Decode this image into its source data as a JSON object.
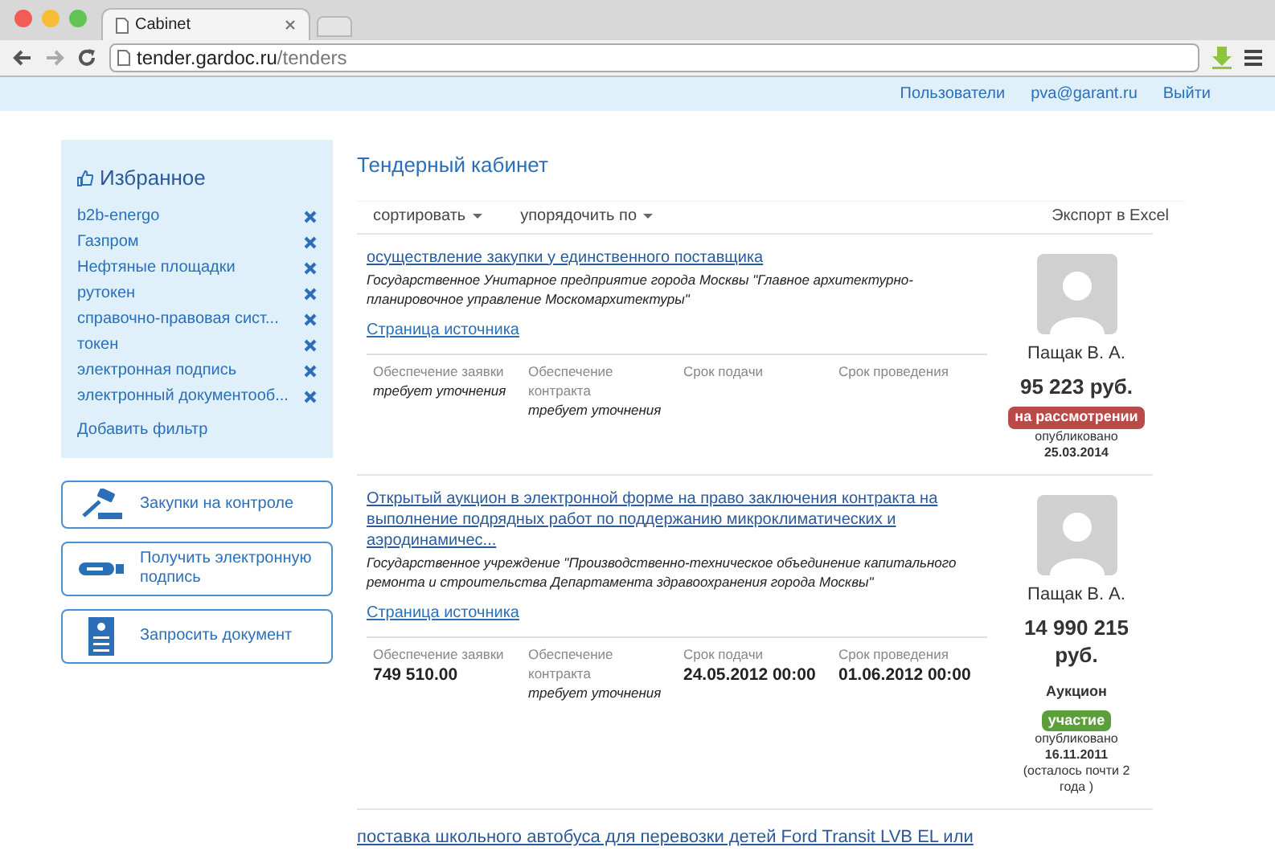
{
  "browser": {
    "tab_title": "Cabinet",
    "url_host": "tender.gardoc.ru",
    "url_path": "/tenders"
  },
  "top_nav": [
    "Пользователи",
    "pva@garant.ru",
    "Выйти"
  ],
  "favorites": {
    "title": "Избранное",
    "items": [
      "b2b-energo",
      "Газпром",
      "Нефтяные площадки",
      "рутокен",
      "справочно-правовая сист...",
      "токен",
      "электронная подпись",
      "электронный документооб..."
    ],
    "add": "Добавить фильтр"
  },
  "actions": [
    {
      "kind": "gavel",
      "label": "Закупки на контроле"
    },
    {
      "kind": "token",
      "label": "Получить электронную подпись"
    },
    {
      "kind": "document",
      "label": "Запросить документ"
    }
  ],
  "page_title": "Тендерный кабинет",
  "toolbar": {
    "sort": "сортировать",
    "order": "упорядочить по",
    "export": "Экспорт в Excel"
  },
  "tenders": [
    {
      "title": "осуществление закупки у единственного поставщика",
      "customer": "Государственное Унитарное предприятие города Москвы \"Главное архитектурно-планировочное управление Москомархитектуры\"",
      "source": "Страница источника",
      "fields": [
        {
          "label": "Обеспечение заявки",
          "value": "требует уточнения",
          "kind": "note"
        },
        {
          "label": "Обеспечение контракта",
          "value": "требует уточнения",
          "kind": "note"
        },
        {
          "label": "Срок подачи"
        },
        {
          "label": "Срок проведения"
        }
      ],
      "person": "Пащак В. А.",
      "price": "95 223 руб.",
      "status": {
        "label": "на рассмотрении",
        "color": "#b94a48"
      },
      "published": "опубликовано",
      "date": "25.03.2014"
    },
    {
      "title": "Открытый аукцион в электронной форме на право заключения контракта на выполнение подрядных работ по поддержанию микроклиматических и аэродинамичес...",
      "customer": "Государственное учреждение \"Производственно-техническое объединение капитального ремонта и строительства Департамента здравоохранения города Москвы\"",
      "source": "Страница источника",
      "fields": [
        {
          "label": "Обеспечение заявки",
          "value": "749 510.00",
          "kind": "amount"
        },
        {
          "label": "Обеспечение контракта",
          "value": "требует уточнения",
          "kind": "note"
        },
        {
          "label": "Срок подачи",
          "value": "24.05.2012 00:00",
          "kind": "amount"
        },
        {
          "label": "Срок проведения",
          "value": "01.06.2012 00:00",
          "kind": "amount"
        }
      ],
      "person": "Пащак В. А.",
      "price": "14 990 215 руб.",
      "type": "Аукцион",
      "status": {
        "label": "участие",
        "color": "#5b9e3a"
      },
      "published": "опубликовано",
      "date": "16.11.2011",
      "remaining": "(осталось почти 2 года )"
    },
    {
      "title": "поставка школьного автобуса для перевозки детей Ford Transit LVB EL или"
    }
  ]
}
